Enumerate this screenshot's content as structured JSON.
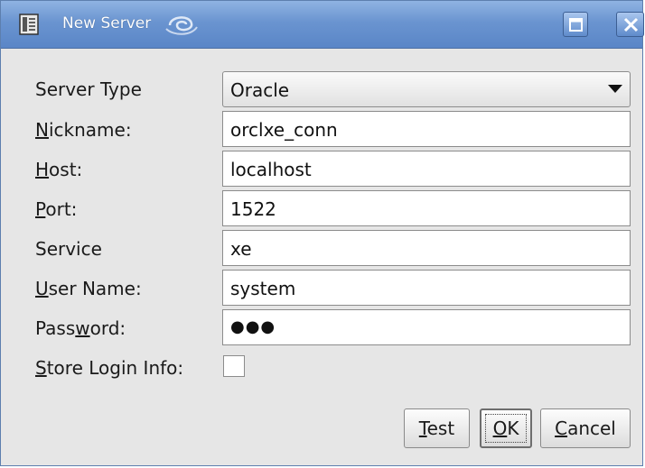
{
  "window": {
    "title": "New Server",
    "icons": {
      "app": "server-app-icon",
      "swirl": "swirl-icon",
      "maximize": "maximize-icon",
      "close": "close-icon"
    }
  },
  "form": {
    "server_type": {
      "label": "Server Type",
      "value": "Oracle"
    },
    "nickname": {
      "label_mnemonic": "N",
      "label_rest": "ickname:",
      "value": "orclxe_conn"
    },
    "host": {
      "label_mnemonic": "H",
      "label_rest": "ost:",
      "value": "localhost"
    },
    "port": {
      "label_mnemonic": "P",
      "label_rest": "ort:",
      "value": "1522"
    },
    "service": {
      "label": "Service",
      "value": "xe"
    },
    "user_name": {
      "label_mnemonic": "U",
      "label_rest": "ser Name:",
      "value": "system"
    },
    "password": {
      "label_before": "Pass",
      "label_mnemonic": "w",
      "label_after": "ord:",
      "value": "●●●"
    },
    "store_login": {
      "label_mnemonic": "S",
      "label_rest": "tore Login Info:",
      "checked": false
    }
  },
  "buttons": {
    "test": {
      "mnemonic": "T",
      "rest": "est"
    },
    "ok": {
      "mnemonic": "O",
      "rest": "K"
    },
    "cancel": {
      "mnemonic": "C",
      "rest": "ancel"
    }
  }
}
